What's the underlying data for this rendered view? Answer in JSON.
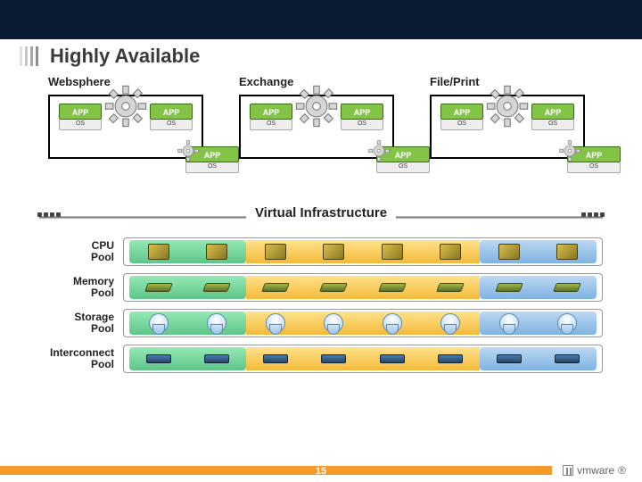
{
  "title": "Highly Available",
  "services": [
    {
      "name": "Websphere"
    },
    {
      "name": "Exchange"
    },
    {
      "name": "File/Print"
    }
  ],
  "app_label": "APP",
  "os_label": "OS",
  "vi_label": "Virtual Infrastructure",
  "pools": [
    {
      "label": "CPU\nPool",
      "icon": "cpu"
    },
    {
      "label": "Memory\nPool",
      "icon": "mem"
    },
    {
      "label": "Storage\nPool",
      "icon": "stor"
    },
    {
      "label": "Interconnect\nPool",
      "icon": "nic"
    }
  ],
  "brand": "vmware",
  "page": "15"
}
